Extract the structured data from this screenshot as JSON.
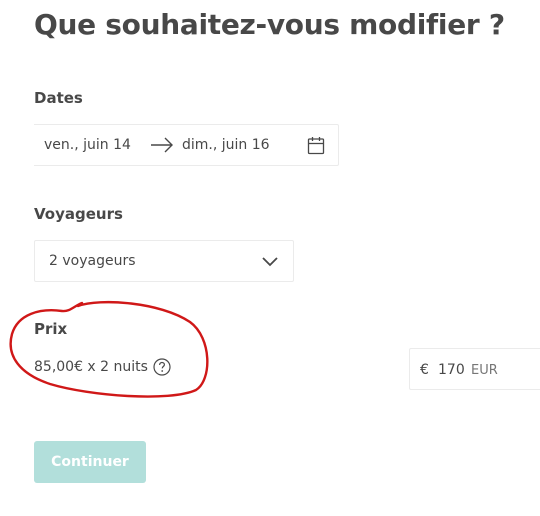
{
  "page": {
    "title": "Que souhaitez-vous modifier ?"
  },
  "dates": {
    "label": "Dates",
    "start": "ven., juin 14",
    "end": "dim., juin 16",
    "arrow_icon": "arrow-right-icon",
    "calendar_icon": "calendar-icon"
  },
  "travellers": {
    "label": "Voyageurs",
    "value": "2 voyageurs",
    "dropdown_icon": "chevron-down-icon"
  },
  "price": {
    "label": "Prix",
    "detail": "85,00€ x 2 nuits",
    "help_icon": "question-circle-icon",
    "currency_symbol": "€",
    "value": "170",
    "currency_code": "EUR"
  },
  "actions": {
    "continue_label": "Continuer"
  },
  "colors": {
    "text": "#484848",
    "border": "#ebebeb",
    "button_disabled": "#b2dfdb",
    "annotation_red": "#d01818"
  }
}
